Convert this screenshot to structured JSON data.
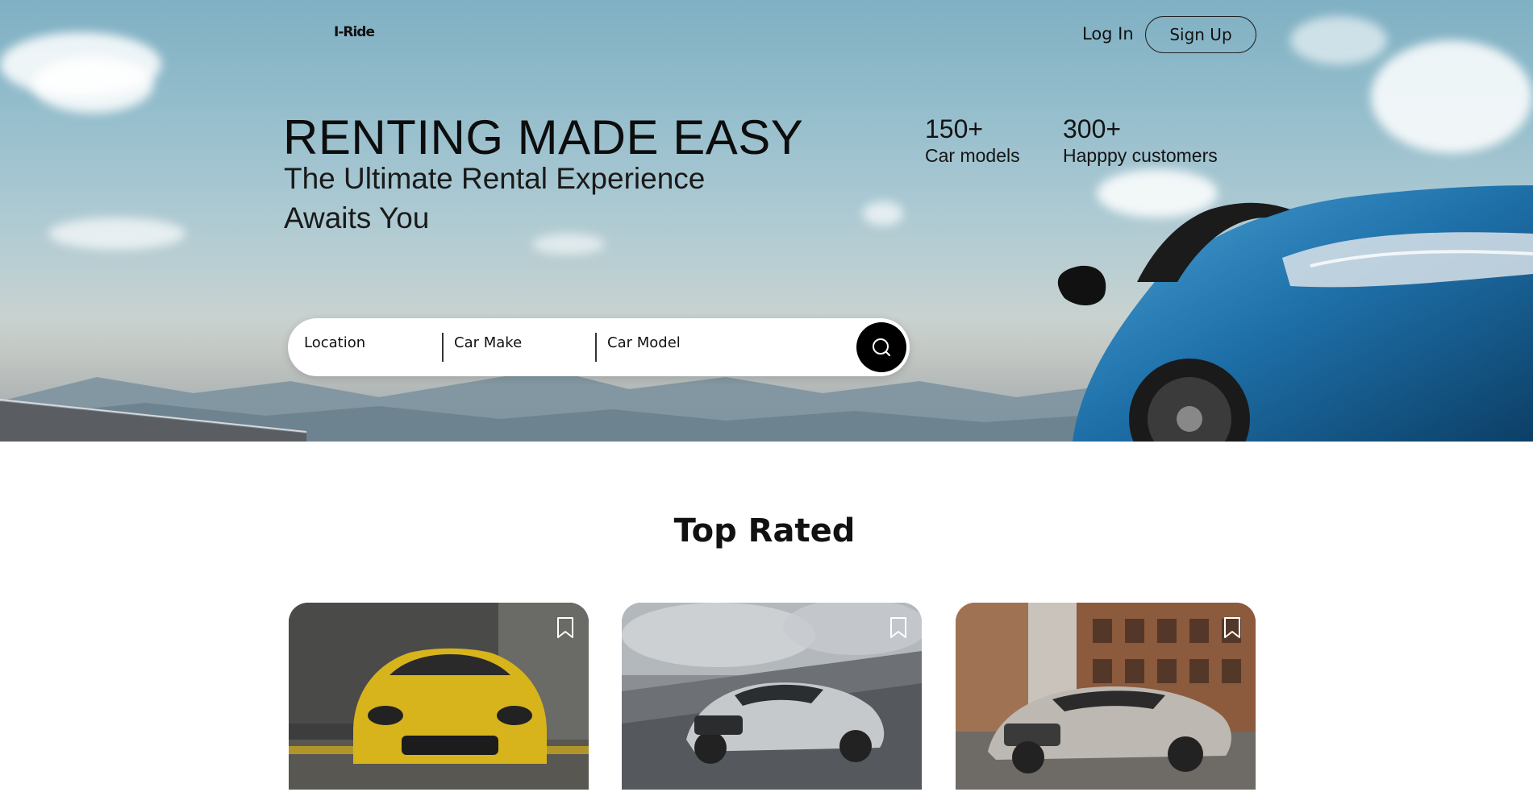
{
  "nav": {
    "logo": "I-Ride",
    "login_label": "Log In",
    "signup_label": "Sign Up"
  },
  "hero": {
    "headline": "RENTING MADE EASY",
    "subheadline": "The Ultimate Rental Experience Awaits You",
    "stats": [
      {
        "value": "150+",
        "label": "Car models"
      },
      {
        "value": "300+",
        "label": "Happpy customers"
      }
    ]
  },
  "search": {
    "fields": [
      {
        "label": "Location"
      },
      {
        "label": "Car Make"
      },
      {
        "label": "Car Model"
      }
    ],
    "button_icon": "search-icon"
  },
  "top_rated": {
    "title": "Top Rated",
    "cards": [
      {
        "car": "yellow sports coupe",
        "bookmark_icon": "bookmark-icon"
      },
      {
        "car": "silver grand tourer",
        "bookmark_icon": "bookmark-icon"
      },
      {
        "car": "silver luxury coupe",
        "bookmark_icon": "bookmark-icon"
      }
    ]
  },
  "colors": {
    "sky": "#8fbacb",
    "accent": "#000000",
    "text": "#111111",
    "card_background": "#ffffff"
  }
}
